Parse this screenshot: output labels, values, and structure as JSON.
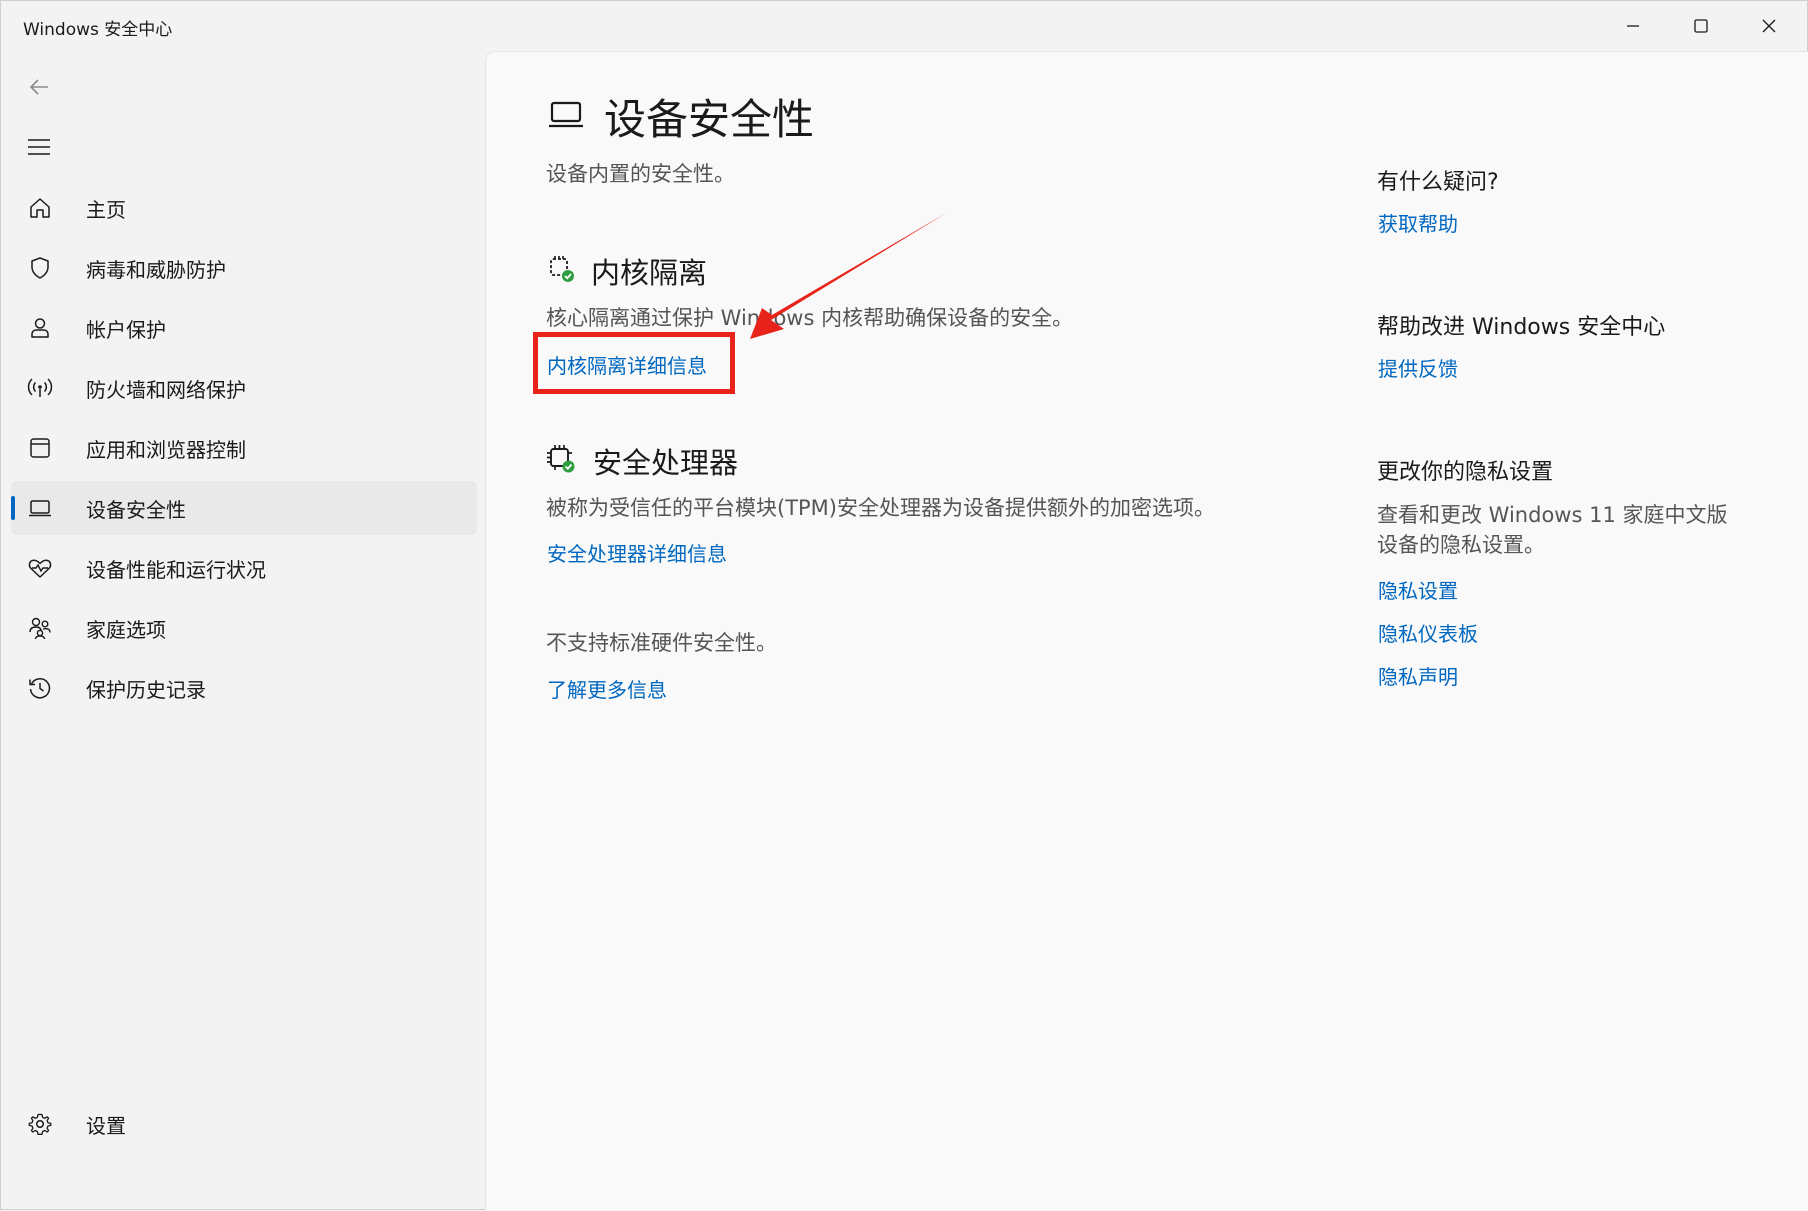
{
  "window": {
    "title": "Windows 安全中心"
  },
  "nav": {
    "items": [
      {
        "label": "主页",
        "icon": "home-icon"
      },
      {
        "label": "病毒和威胁防护",
        "icon": "shield-icon"
      },
      {
        "label": "帐户保护",
        "icon": "person-icon"
      },
      {
        "label": "防火墙和网络保护",
        "icon": "wifi-antenna-icon"
      },
      {
        "label": "应用和浏览器控制",
        "icon": "app-window-icon"
      },
      {
        "label": "设备安全性",
        "icon": "laptop-icon",
        "active": true
      },
      {
        "label": "设备性能和运行状况",
        "icon": "heart-pulse-icon"
      },
      {
        "label": "家庭选项",
        "icon": "family-icon"
      },
      {
        "label": "保护历史记录",
        "icon": "history-icon"
      }
    ],
    "settings_label": "设置"
  },
  "main": {
    "title": "设备安全性",
    "subtitle": "设备内置的安全性。",
    "core_isolation": {
      "title": "内核隔离",
      "desc": "核心隔离通过保护 Windows 内核帮助确保设备的安全。",
      "link": "内核隔离详细信息"
    },
    "security_processor": {
      "title": "安全处理器",
      "desc": "被称为受信任的平台模块(TPM)安全处理器为设备提供额外的加密选项。",
      "link": "安全处理器详细信息"
    },
    "hardware": {
      "desc": "不支持标准硬件安全性。",
      "link": "了解更多信息"
    }
  },
  "side": {
    "question_title": "有什么疑问?",
    "get_help": "获取帮助",
    "improve_title": "帮助改进 Windows 安全中心",
    "feedback": "提供反馈",
    "privacy_title": "更改你的隐私设置",
    "privacy_desc": "查看和更改 Windows 11 家庭中文版设备的隐私设置。",
    "privacy_links": [
      "隐私设置",
      "隐私仪表板",
      "隐私声明"
    ]
  },
  "colors": {
    "accent": "#0067c0",
    "annotation": "#e8231a",
    "check_green": "#2e9e3e"
  }
}
